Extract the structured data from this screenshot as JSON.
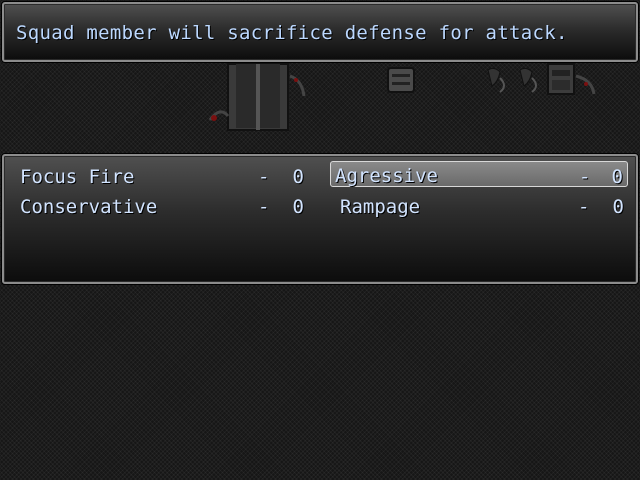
{
  "help": {
    "text": "Squad member will sacrifice defense for attack."
  },
  "commands": [
    {
      "label": "Focus Fire",
      "dash": "-",
      "value": "0",
      "selected": false
    },
    {
      "label": "Agressive",
      "dash": "-",
      "value": "0",
      "selected": true
    },
    {
      "label": "Conservative",
      "dash": "-",
      "value": "0",
      "selected": false
    },
    {
      "label": "Rampage",
      "dash": "-",
      "value": "0",
      "selected": false
    }
  ],
  "colors": {
    "help_text": "#bcd8ff",
    "command_text": "#d2e4ff",
    "window_border": "#8c8c8c",
    "selection_fill": "#7a7a7a"
  },
  "icons": [
    "door-sprite",
    "barrel-sprite",
    "machine-sprite"
  ]
}
